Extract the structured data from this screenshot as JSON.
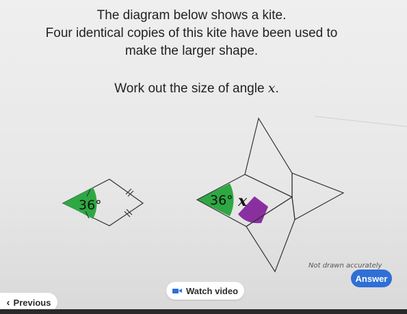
{
  "question": {
    "lines": [
      "The diagram below shows a kite.",
      "Four identical copies of this kite have been used to",
      "make the larger shape."
    ],
    "task_prefix": "Work out the size of angle ",
    "task_var": "x",
    "task_suffix": "."
  },
  "diagram": {
    "kite_angle": "36°",
    "shape_angle": "36°",
    "unknown_angle": "x",
    "note": "Not drawn accurately",
    "angle_color": "#2ea843",
    "unknown_color": "#8a2fa0"
  },
  "buttons": {
    "answer": "Answer",
    "watch_video": "Watch video",
    "previous": "Previous"
  }
}
